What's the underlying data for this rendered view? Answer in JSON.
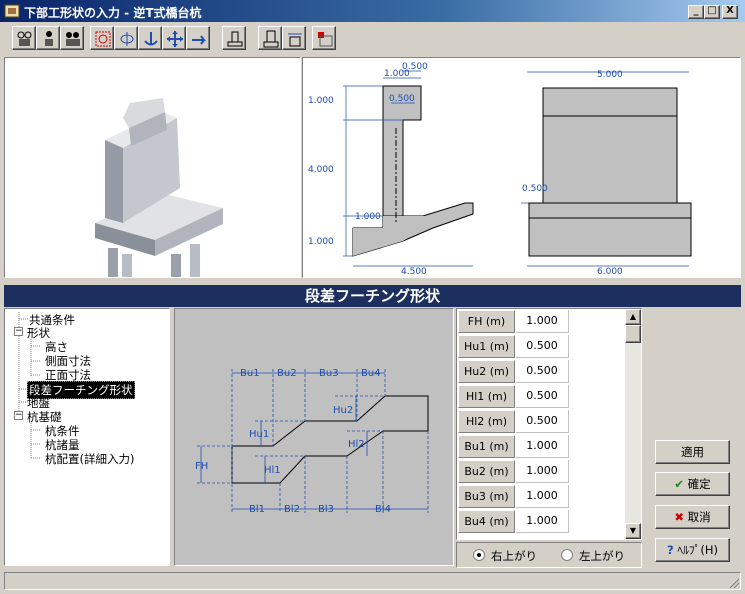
{
  "window": {
    "title": "下部工形状の入力 - 逆T式橋台杭"
  },
  "titlebar_buttons": [
    "_",
    "□",
    "X"
  ],
  "toolbar": {
    "icons": [
      "film-camera-icon",
      "person-camera-icon",
      "group-camera-icon",
      "rotate-icon",
      "rotate-vertical-icon",
      "anchor-icon",
      "move-icon",
      "hand-icon",
      "foundation-icon",
      "section-icon",
      "dimension-icon",
      "grid-icon"
    ]
  },
  "top_view": {
    "side_dims": {
      "w1": "1.000",
      "w2": "0.500",
      "w3": "0.500",
      "h1": "1.000",
      "h2": "4.000",
      "step": "1.000",
      "base": "1.000",
      "bottom": "4.500"
    },
    "front_dims": {
      "top": "5.000",
      "ledge": "0.500",
      "bottom": "6.000"
    }
  },
  "section_header": "段差フーチング形状",
  "tree": {
    "items": [
      {
        "label": "共通条件"
      },
      {
        "label": "形状"
      },
      {
        "label": "高さ"
      },
      {
        "label": "側面寸法"
      },
      {
        "label": "正面寸法"
      },
      {
        "label": "段差フーチング形状"
      },
      {
        "label": "地盤"
      },
      {
        "label": "杭基礎"
      },
      {
        "label": "杭条件"
      },
      {
        "label": "杭諸量"
      },
      {
        "label": "杭配置(詳細入力)"
      }
    ],
    "expand_sign": "−"
  },
  "diagram_labels": {
    "bu1": "Bu1",
    "bu2": "Bu2",
    "bu3": "Bu3",
    "bu4": "Bu4",
    "bl1": "Bl1",
    "bl2": "Bl2",
    "bl3": "Bl3",
    "bl4": "Bl4",
    "hu1": "Hu1",
    "hu2": "Hu2",
    "hl1": "Hl1",
    "hl2": "Hl2",
    "fh": "FH"
  },
  "table": {
    "rows": [
      {
        "label": "FH (m)",
        "value": "1.000"
      },
      {
        "label": "Hu1 (m)",
        "value": "0.500"
      },
      {
        "label": "Hu2 (m)",
        "value": "0.500"
      },
      {
        "label": "Hl1 (m)",
        "value": "0.500"
      },
      {
        "label": "Hl2 (m)",
        "value": "0.500"
      },
      {
        "label": "Bu1 (m)",
        "value": "1.000"
      },
      {
        "label": "Bu2 (m)",
        "value": "1.000"
      },
      {
        "label": "Bu3 (m)",
        "value": "1.000"
      },
      {
        "label": "Bu4 (m)",
        "value": "1.000"
      }
    ]
  },
  "radios": {
    "up_right": "右上がり",
    "up_left": "左上がり"
  },
  "buttons": {
    "apply": "適用",
    "ok": "確定",
    "cancel": "取消",
    "help": "ﾍﾙﾌﾟ(H)"
  },
  "colors": {
    "title_start": "#0a246a",
    "section_header": "#1c2f5e",
    "dim_blue": "#1f4fae",
    "select_red": "#cc0000"
  }
}
